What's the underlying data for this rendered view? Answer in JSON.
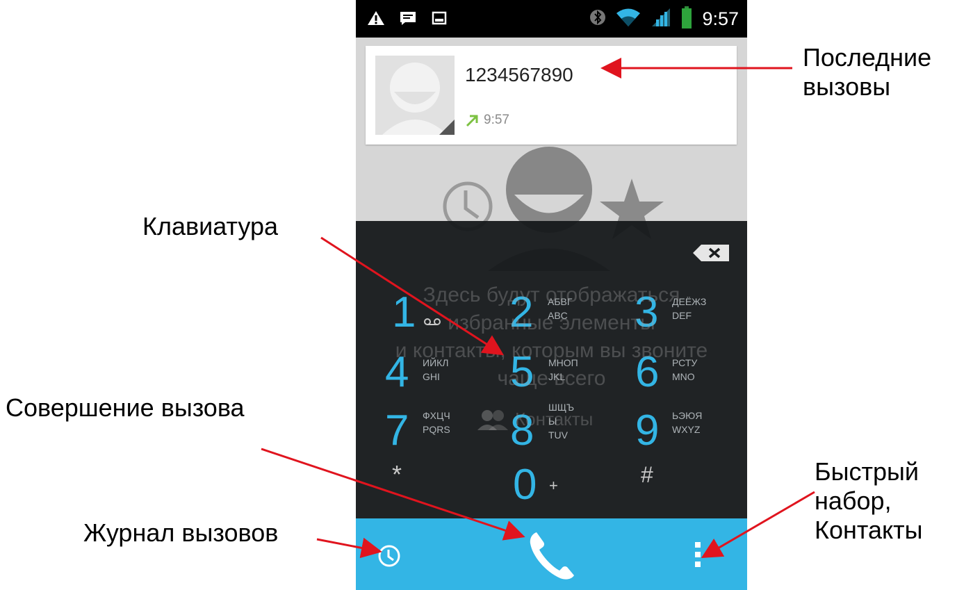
{
  "status_bar": {
    "time": "9:57",
    "left_icons": [
      "warning-icon",
      "message-icon",
      "image-icon"
    ],
    "right_icons": [
      "bluetooth-icon",
      "wifi-icon",
      "signal-icon",
      "battery-icon"
    ]
  },
  "recent_call": {
    "number": "1234567890",
    "time": "9:57",
    "direction_icon": "outgoing-call-arrow-icon"
  },
  "empty_state": {
    "line1": "Здесь будут отображаться",
    "line2": "избранные элементы",
    "line3": "и контакты, которым вы звоните",
    "line4": "чаще всего",
    "contacts_label": "Контакты"
  },
  "dialpad": {
    "keys": [
      {
        "digit": "1",
        "letters": ""
      },
      {
        "digit": "2",
        "letters": "АБВГ\nABC"
      },
      {
        "digit": "3",
        "letters": "ДЕЁЖЗ\nDEF"
      },
      {
        "digit": "4",
        "letters": "ИЙКЛ\nGHI"
      },
      {
        "digit": "5",
        "letters": "МНОП\nJKL"
      },
      {
        "digit": "6",
        "letters": "РСТУ\nMNO"
      },
      {
        "digit": "7",
        "letters": "ФХЦЧ\nPQRS"
      },
      {
        "digit": "8",
        "letters": "ШЩЪ\nЫ\nTUV"
      },
      {
        "digit": "9",
        "letters": "ЬЭЮЯ\nWXYZ"
      },
      {
        "digit": "*",
        "letters": ""
      },
      {
        "digit": "0",
        "letters": "+"
      },
      {
        "digit": "#",
        "letters": ""
      }
    ]
  },
  "colors": {
    "accent": "#33b5e5",
    "dialpad_bg": "#121618",
    "annotation_arrow": "#e0141e",
    "call_arrow": "#7cc142"
  },
  "annotations": {
    "recent_calls": "Последние\nвызовы",
    "keypad": "Клавиатура",
    "make_call": "Совершение вызова",
    "call_log": "Журнал вызовов",
    "speed_dial": "Быстрый\nнабор,\nКонтакты"
  }
}
